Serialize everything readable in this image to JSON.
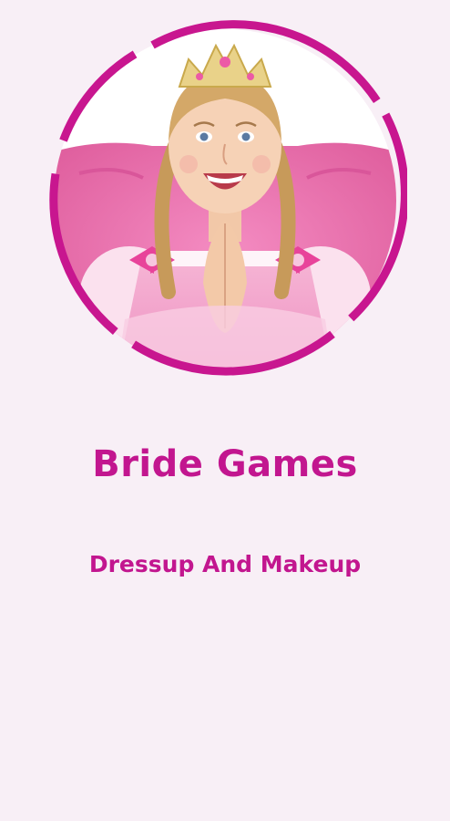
{
  "app": {
    "title": "Bride Games",
    "subtitle": "Dressup And Makeup"
  },
  "hero": {
    "image_icon": "girl-princess-portrait",
    "ring_icon": "segmented-ring"
  },
  "colors": {
    "background": "#f8eff6",
    "accent": "#c2168f",
    "ring": "#c8168f",
    "chair": "#ea7fb6",
    "dress": "#f4a6cf"
  }
}
